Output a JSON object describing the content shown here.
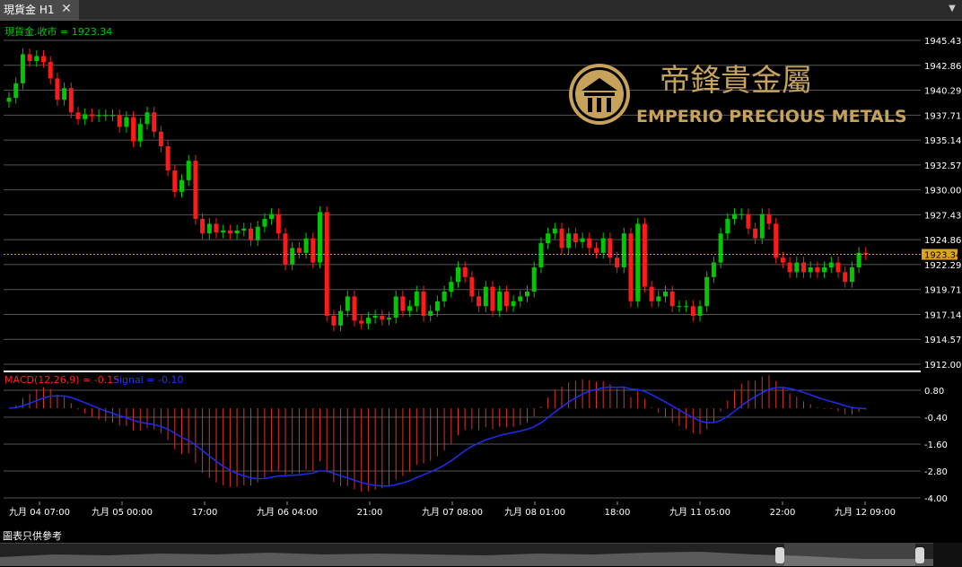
{
  "tab": {
    "title": "現貨金 H1",
    "close_glyph": "✕",
    "menu_glyph": "▼"
  },
  "chart": {
    "label": "現貨金.收市 = 1923.34",
    "current_price": "1923.34",
    "price_ticks": [
      "1945.43",
      "1942.86",
      "1940.29",
      "1937.71",
      "1935.14",
      "1932.57",
      "1930.00",
      "1927.43",
      "1924.86",
      "1922.29",
      "1919.71",
      "1917.14",
      "1914.57",
      "1912.00"
    ],
    "macd_label": "MACD(12,26,9) = -0.15",
    "signal_label": "Signal = -0.10",
    "macd_ticks": [
      "0.80",
      "-0.40",
      "-1.60",
      "-2.80",
      "-4.00"
    ],
    "time_labels": [
      "九月 04 07:00",
      "九月 05 00:00",
      "17:00",
      "九月 06 04:00",
      "21:00",
      "九月 07 08:00",
      "九月 08 01:00",
      "18:00",
      "九月 11 05:00",
      "22:00",
      "九月 12 09:00"
    ],
    "colors": {
      "up": "#00c800",
      "down": "#ff1a1a",
      "grid": "#555555",
      "signal": "#1a2ff0",
      "price_line": "#e0a000"
    }
  },
  "logo": {
    "chinese": "帝鋒貴金屬",
    "english": "EMPERIO PRECIOUS METALS"
  },
  "caption": "圖表只供參考",
  "chart_data": {
    "type": "candlestick",
    "symbol": "現貨金",
    "timeframe": "H1",
    "last_close": 1923.34,
    "closes": [
      1939.5,
      1941.0,
      1944.0,
      1943.3,
      1943.8,
      1943.2,
      1941.5,
      1939.3,
      1940.5,
      1938.0,
      1937.3,
      1937.8,
      1937.6,
      1937.7,
      1937.7,
      1937.7,
      1936.5,
      1937.5,
      1935.0,
      1936.8,
      1938.0,
      1936.0,
      1934.5,
      1932.0,
      1929.8,
      1931.0,
      1933.0,
      1927.0,
      1925.5,
      1926.5,
      1925.6,
      1925.8,
      1925.5,
      1925.8,
      1926.0,
      1924.8,
      1926.2,
      1927.0,
      1927.5,
      1925.5,
      1922.3,
      1924.0,
      1923.5,
      1925.0,
      1922.5,
      1927.7,
      1917.0,
      1916.0,
      1917.5,
      1919.0,
      1916.5,
      1916.2,
      1916.8,
      1917.0,
      1916.6,
      1916.8,
      1919.0,
      1917.5,
      1918.0,
      1919.5,
      1917.0,
      1917.5,
      1918.5,
      1919.5,
      1920.5,
      1922.0,
      1921.0,
      1919.0,
      1918.0,
      1920.0,
      1917.5,
      1919.5,
      1918.0,
      1918.5,
      1919.0,
      1919.5,
      1922.0,
      1924.5,
      1925.5,
      1926.0,
      1924.0,
      1925.5,
      1924.6,
      1925.0,
      1924.0,
      1923.5,
      1925.0,
      1923.0,
      1922.0,
      1925.5,
      1918.5,
      1926.5,
      1920.0,
      1918.5,
      1919.0,
      1919.5,
      1918.0,
      1918.0,
      1918.0,
      1917.0,
      1918.0,
      1921.0,
      1922.5,
      1925.5,
      1927.0,
      1927.5,
      1927.5,
      1926.0,
      1925.0,
      1927.5,
      1926.5,
      1923.0,
      1922.5,
      1921.5,
      1922.5,
      1921.5,
      1922.0,
      1921.5,
      1922.0,
      1922.5,
      1921.5,
      1920.5,
      1922.0,
      1923.5,
      1923.34
    ],
    "macd": {
      "value": -0.15,
      "signal": -0.1
    }
  }
}
